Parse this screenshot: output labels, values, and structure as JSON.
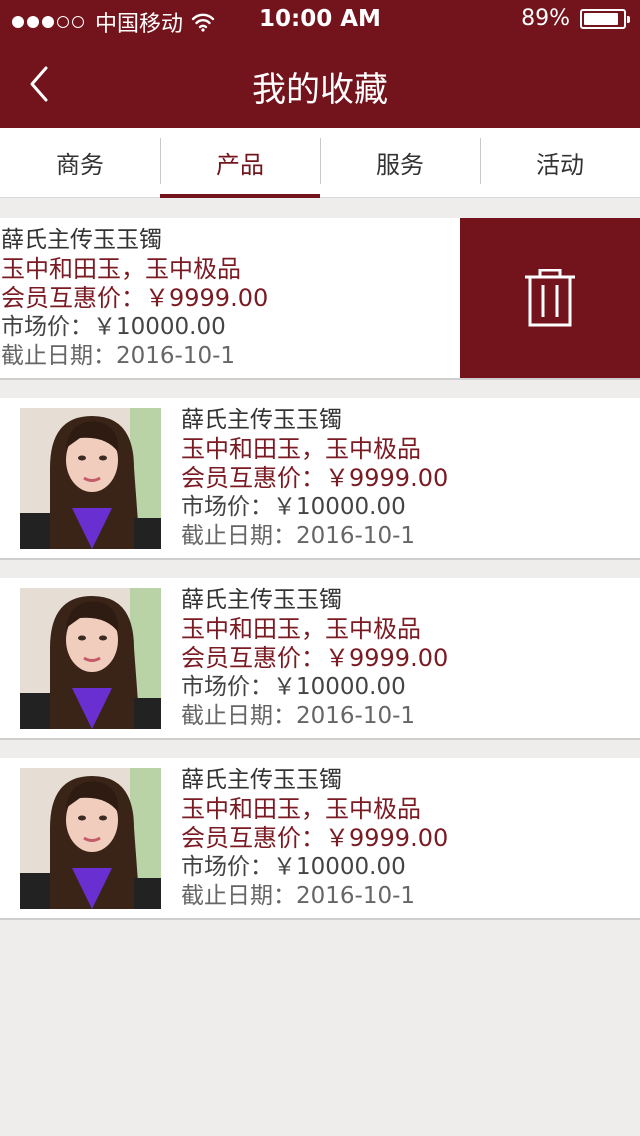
{
  "status_bar": {
    "carrier": "中国移动",
    "time": "10:00 AM",
    "battery": "89%",
    "battery_level": 0.89,
    "signal_dots_filled": 3,
    "signal_dots_total": 5
  },
  "nav": {
    "title": "我的收藏",
    "back_icon": "chevron-left-icon"
  },
  "tabs": [
    {
      "label": "商务",
      "active": false
    },
    {
      "label": "产品",
      "active": true
    },
    {
      "label": "服务",
      "active": false
    },
    {
      "label": "活动",
      "active": false
    }
  ],
  "items": [
    {
      "name": "薛氏主传玉玉镯",
      "slogan": "玉中和田玉，玉中极品",
      "member_price": "会员互惠价：￥9999.00",
      "market_price": "市场价：￥10000.00",
      "deadline": "截止日期：2016-10-1",
      "swiped": true
    },
    {
      "name": "薛氏主传玉玉镯",
      "slogan": "玉中和田玉，玉中极品",
      "member_price": "会员互惠价：￥9999.00",
      "market_price": "市场价：￥10000.00",
      "deadline": "截止日期：2016-10-1",
      "swiped": false
    },
    {
      "name": "薛氏主传玉玉镯",
      "slogan": "玉中和田玉，玉中极品",
      "member_price": "会员互惠价：￥9999.00",
      "market_price": "市场价：￥10000.00",
      "deadline": "截止日期：2016-10-1",
      "swiped": false
    },
    {
      "name": "薛氏主传玉玉镯",
      "slogan": "玉中和田玉，玉中极品",
      "member_price": "会员互惠价：￥9999.00",
      "market_price": "市场价：￥10000.00",
      "deadline": "截止日期：2016-10-1",
      "swiped": false
    }
  ],
  "colors": {
    "brand": "#73141c",
    "accent_text": "#7a1a22",
    "background": "#eeedeb"
  },
  "icons": {
    "delete": "trash-icon",
    "wifi": "wifi-icon",
    "battery": "battery-icon"
  }
}
